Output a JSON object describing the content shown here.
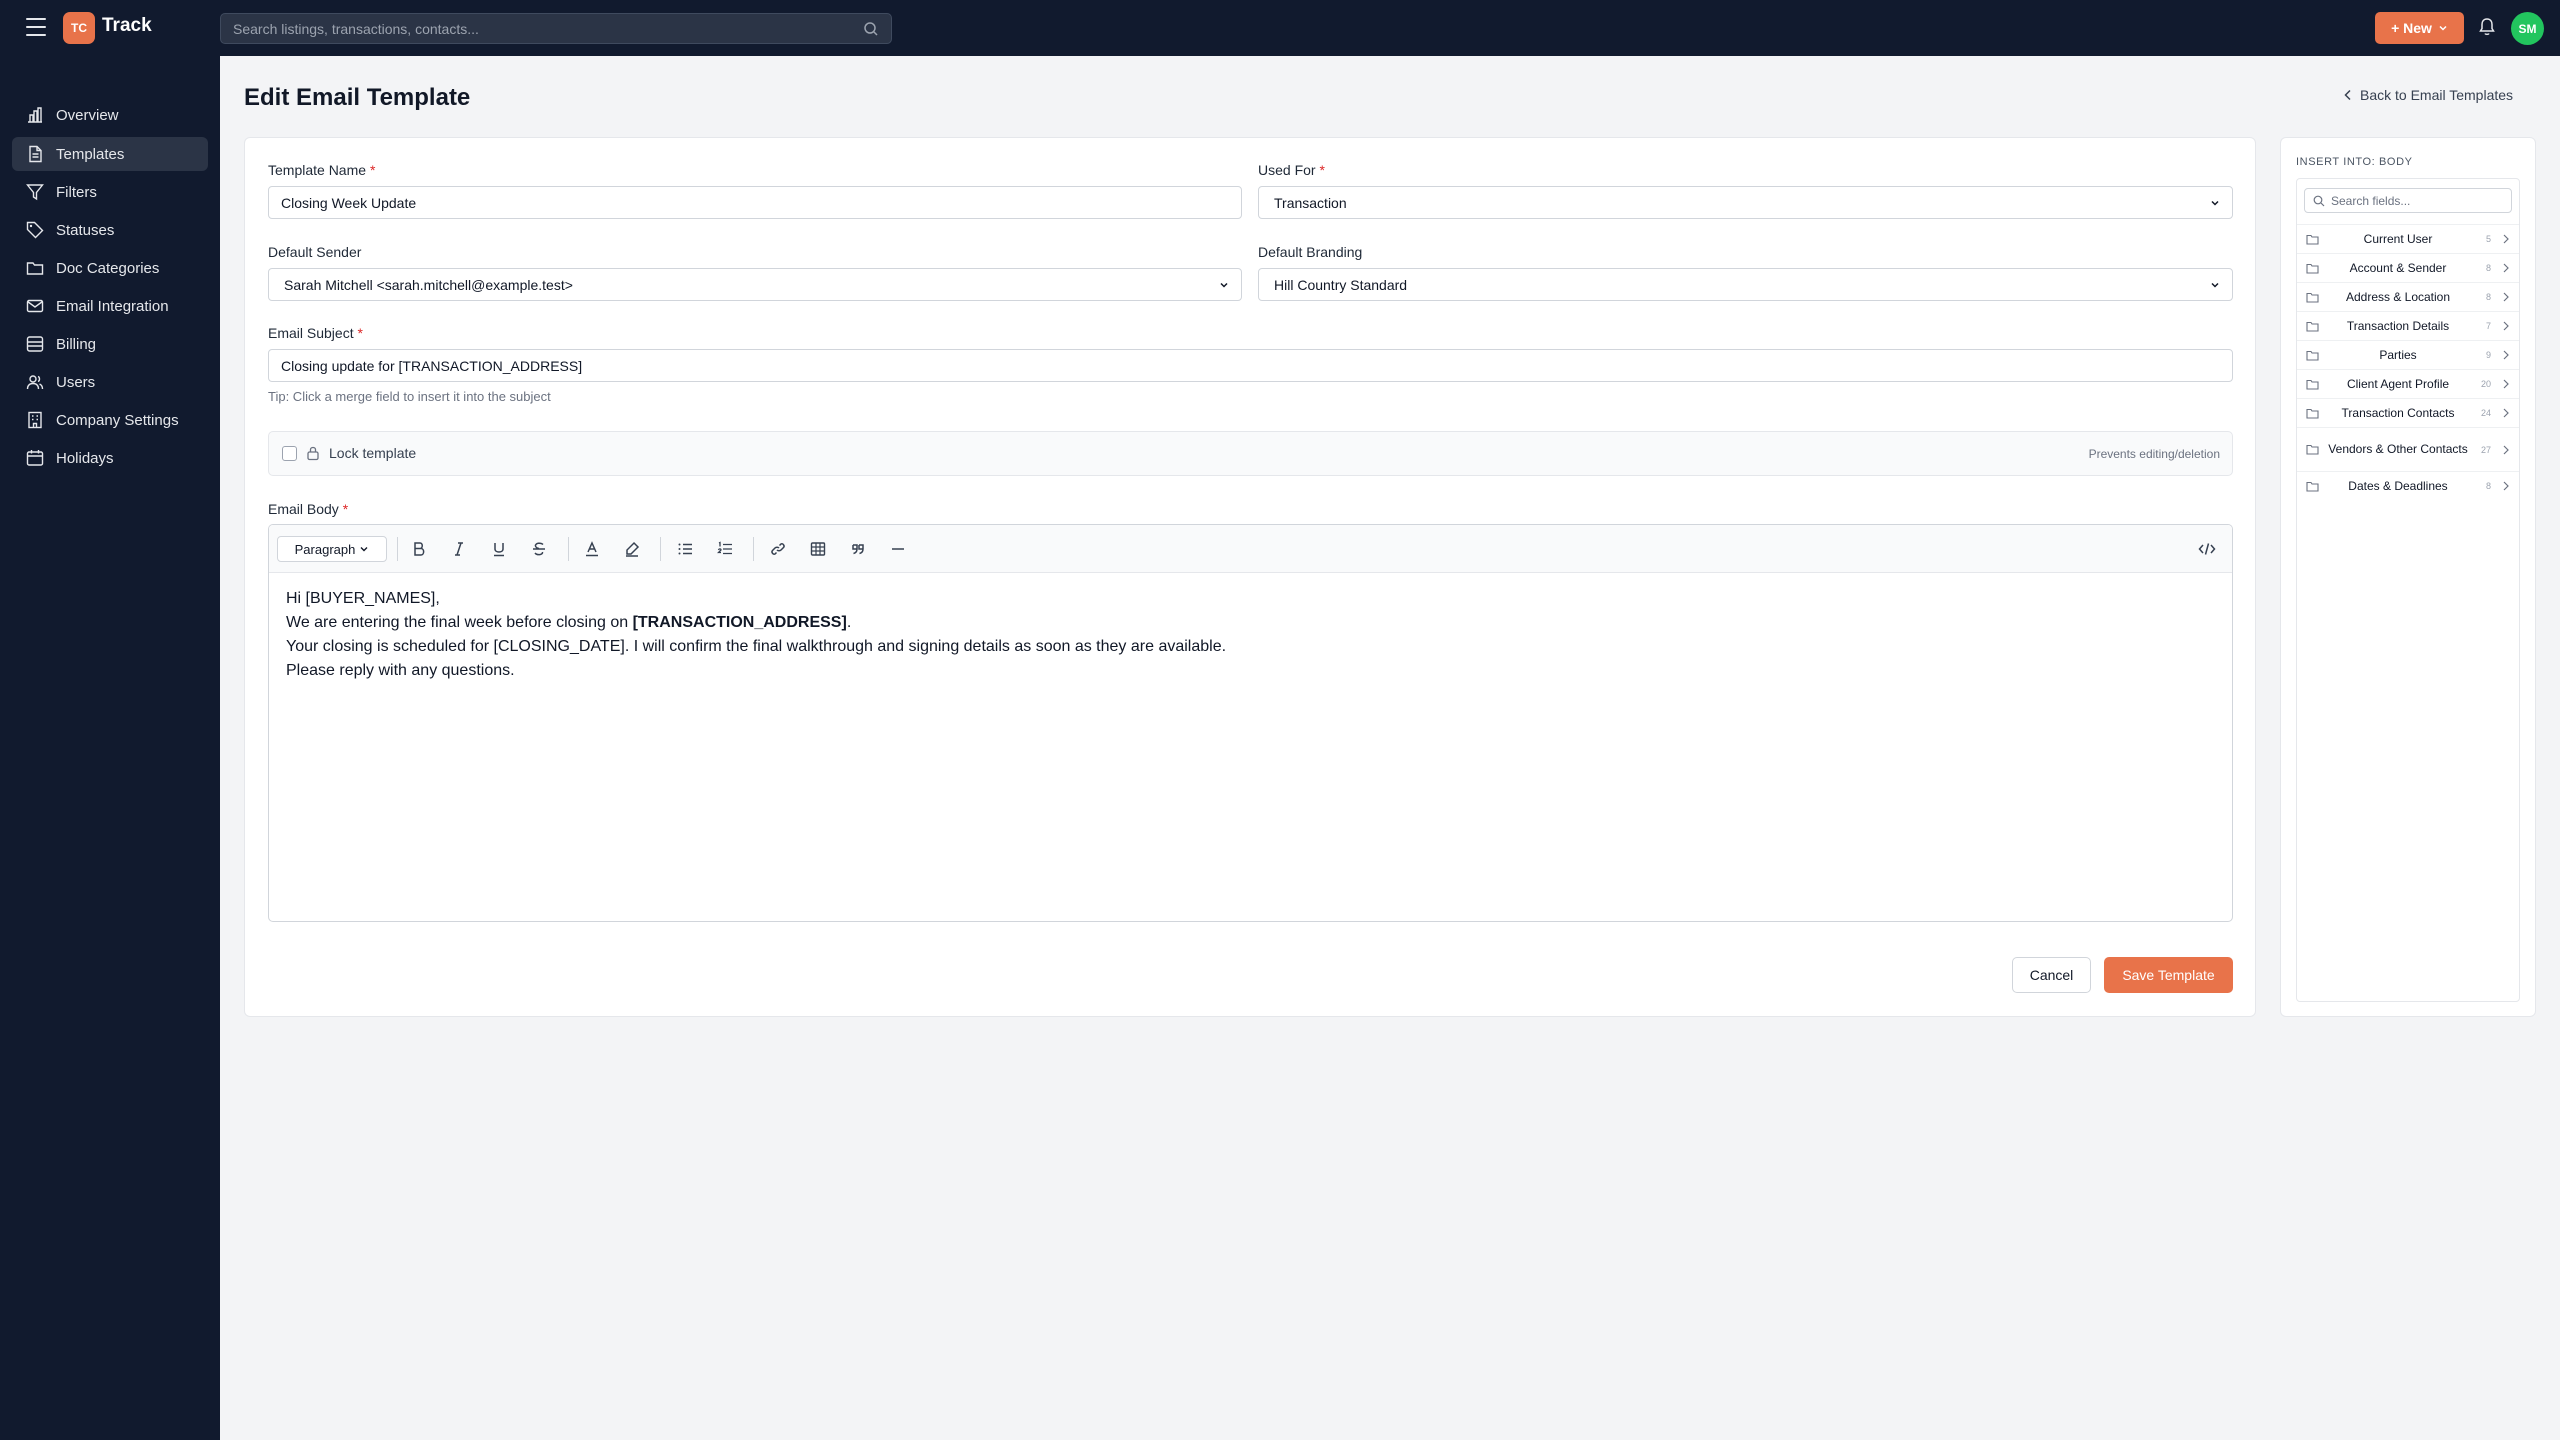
{
  "app": {
    "logo_badge": "TC",
    "name": "Track",
    "avatar_initials": "SM",
    "new_label": "+ New"
  },
  "search": {
    "placeholder": "Search listings, transactions, contacts..."
  },
  "sidebar": {
    "items": [
      {
        "label": "Overview",
        "icon": "chart-icon"
      },
      {
        "label": "Templates",
        "icon": "document-icon",
        "active": true
      },
      {
        "label": "Filters",
        "icon": "filter-icon"
      },
      {
        "label": "Statuses",
        "icon": "tag-icon"
      },
      {
        "label": "Doc Categories",
        "icon": "folder-icon"
      },
      {
        "label": "Email Integration",
        "icon": "mail-icon"
      },
      {
        "label": "Billing",
        "icon": "billing-icon"
      },
      {
        "label": "Users",
        "icon": "users-icon"
      },
      {
        "label": "Company Settings",
        "icon": "building-icon"
      },
      {
        "label": "Holidays",
        "icon": "calendar-icon"
      }
    ]
  },
  "page": {
    "title": "Edit Email Template",
    "back_label": "Back to Email Templates"
  },
  "form": {
    "template_name": {
      "label": "Template Name",
      "required": "*",
      "value": "Closing Week Update"
    },
    "used_for": {
      "label": "Used For",
      "required": "*",
      "value": "Transaction"
    },
    "default_sender": {
      "label": "Default Sender",
      "value": "Sarah Mitchell <sarah.mitchell@example.test>"
    },
    "default_branding": {
      "label": "Default Branding",
      "value": "Hill Country Standard"
    },
    "email_subject": {
      "label": "Email Subject",
      "required": "*",
      "value": "Closing update for [TRANSACTION_ADDRESS]",
      "tip": "Tip: Click a merge field to insert it into the subject"
    },
    "lock": {
      "label": "Lock template",
      "note": "Prevents editing/deletion",
      "checked": false
    },
    "email_body": {
      "label": "Email Body",
      "required": "*",
      "format": "Paragraph",
      "lines": [
        {
          "text": "Hi [BUYER_NAMES],"
        },
        {
          "before": "We are entering the final week before closing on ",
          "bold": "[TRANSACTION_ADDRESS]",
          "after": "."
        },
        {
          "text": "Your closing is scheduled for [CLOSING_DATE]. I will confirm the final walkthrough and signing details as soon as they are available."
        },
        {
          "text": "Please reply with any questions."
        }
      ]
    },
    "cancel_label": "Cancel",
    "save_label": "Save Template"
  },
  "insert_panel": {
    "title": "INSERT INTO: BODY",
    "search_placeholder": "Search fields...",
    "groups": [
      {
        "name": "Current User",
        "count": "5"
      },
      {
        "name": "Account & Sender",
        "count": "8"
      },
      {
        "name": "Address & Location",
        "count": "8"
      },
      {
        "name": "Transaction Details",
        "count": "7"
      },
      {
        "name": "Parties",
        "count": "9"
      },
      {
        "name": "Client Agent Profile",
        "count": "20"
      },
      {
        "name": "Transaction Contacts",
        "count": "24"
      },
      {
        "name": "Vendors & Other Contacts",
        "count": "27"
      },
      {
        "name": "Dates & Deadlines",
        "count": "8"
      }
    ]
  },
  "colors": {
    "accent": "#e8734a",
    "nav_bg": "#111a2e",
    "avatar": "#22c55e",
    "required": "#dc2626"
  }
}
